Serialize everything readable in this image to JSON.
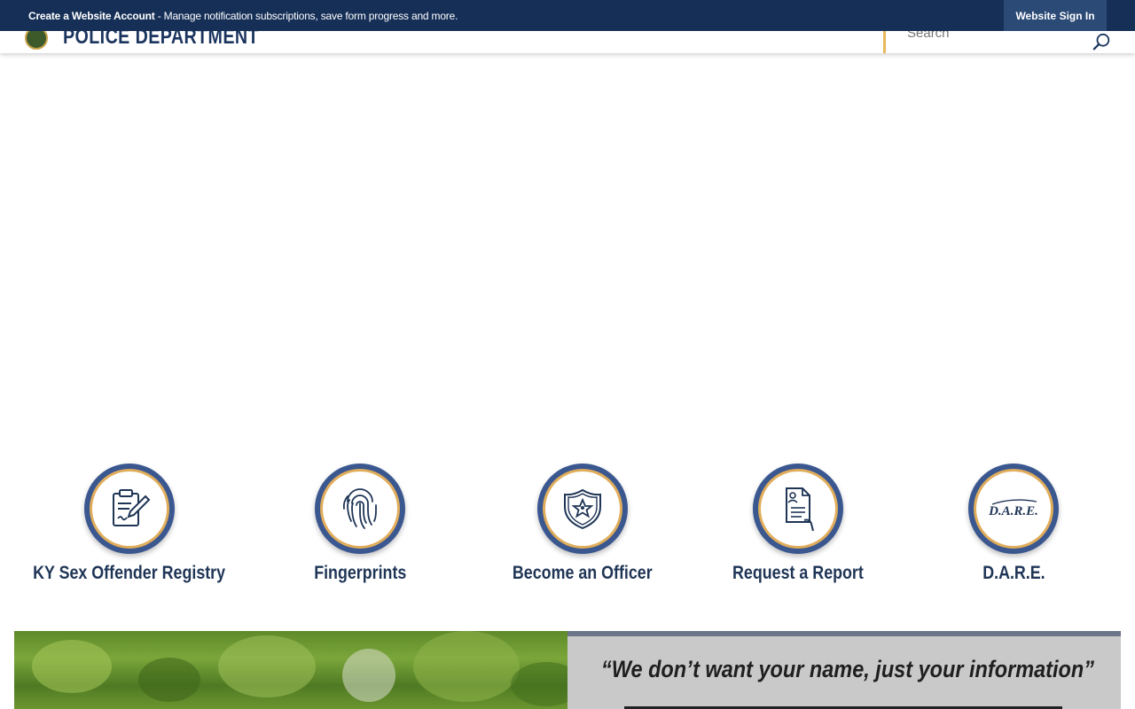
{
  "topbar": {
    "create_account_label": "Create a Website Account",
    "message": " - Manage notification subscriptions, save form progress and more.",
    "signin_label": "Website Sign In"
  },
  "header": {
    "logo_text": "POLICE DEPARTMENT",
    "search_placeholder": "Search"
  },
  "quick_links": [
    {
      "label": "KY Sex Offender Registry",
      "icon": "clipboard-pen-icon"
    },
    {
      "label": "Fingerprints",
      "icon": "fingerprint-icon"
    },
    {
      "label": "Become an Officer",
      "icon": "shield-star-icon"
    },
    {
      "label": "Request a Report",
      "icon": "document-hand-icon"
    },
    {
      "label": "D.A.R.E.",
      "icon": "dare-logo"
    }
  ],
  "tip_panel": {
    "quote": "“We don’t want your name, just your information”"
  },
  "colors": {
    "topbar_bg": "#152f57",
    "ring_blue": "#3a5790",
    "ring_gold": "#e0ad5b",
    "label_navy": "#1f3556"
  }
}
